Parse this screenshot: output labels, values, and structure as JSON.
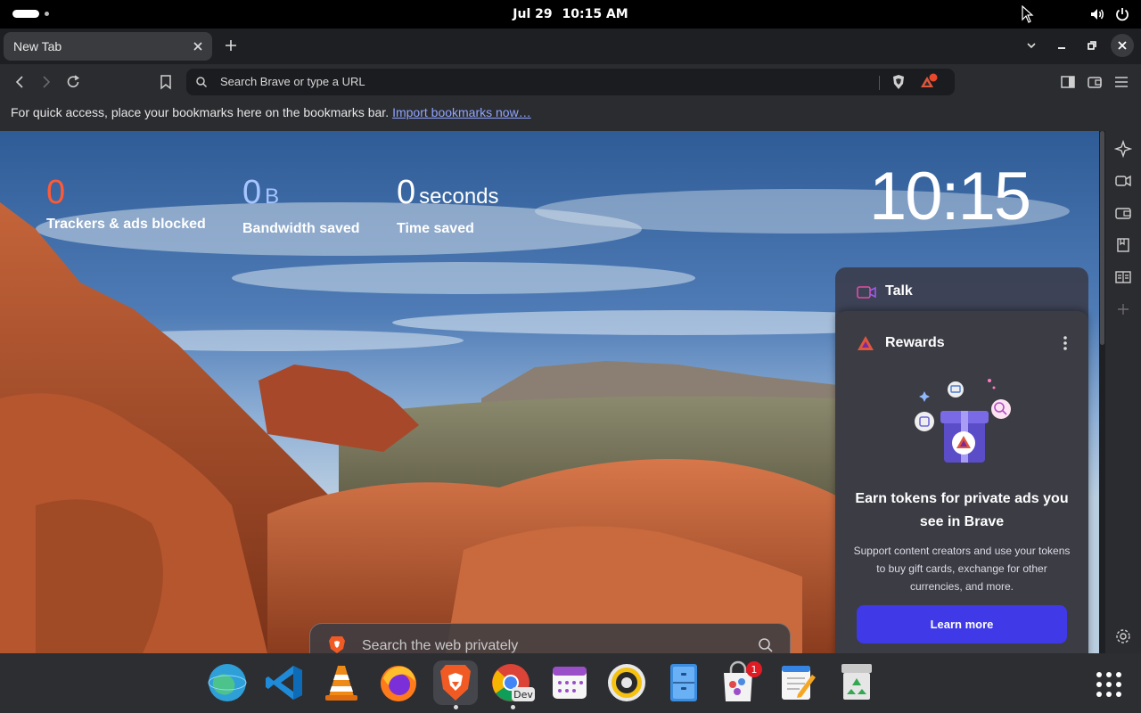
{
  "system": {
    "date": "Jul 29",
    "time": "10:15 AM"
  },
  "browser": {
    "tab_title": "New Tab",
    "omnibox_placeholder": "Search Brave or type a URL",
    "bookmarks_message": "For quick access, place your bookmarks here on the bookmarks bar.",
    "bookmarks_link": "Import bookmarks now…",
    "shield_badge_color": "#e8492c"
  },
  "stats": {
    "trackers": {
      "value": "0",
      "unit": "",
      "label": "Trackers & ads blocked"
    },
    "bandwidth": {
      "value": "0",
      "unit": "B",
      "label": "Bandwidth saved"
    },
    "time": {
      "value": "0",
      "unit": "seconds",
      "label": "Time saved"
    }
  },
  "clock": "10:15",
  "talk": {
    "title": "Talk"
  },
  "rewards": {
    "title": "Rewards",
    "headline": "Earn tokens for private ads you see in Brave",
    "description": "Support content creators and use your tokens to buy gift cards, exchange for other currencies, and more.",
    "button": "Learn more",
    "button_color": "#3f39e8"
  },
  "search": {
    "placeholder": "Search the web privately"
  },
  "dock": {
    "apps": [
      {
        "name": "Web Browser",
        "icon": "globe-icon"
      },
      {
        "name": "Visual Studio Code",
        "icon": "vscode-icon"
      },
      {
        "name": "VLC",
        "icon": "vlc-cone-icon"
      },
      {
        "name": "Firefox",
        "icon": "firefox-icon"
      },
      {
        "name": "Brave",
        "icon": "brave-lion-icon",
        "active": true
      },
      {
        "name": "Chrome Dev",
        "icon": "chrome-dev-icon",
        "label": "Dev",
        "running": true
      },
      {
        "name": "Calendar",
        "icon": "calendar-icon"
      },
      {
        "name": "Rhythmbox",
        "icon": "speaker-icon"
      },
      {
        "name": "Files",
        "icon": "file-cabinet-icon"
      },
      {
        "name": "Software",
        "icon": "software-bag-icon",
        "badge": "1"
      },
      {
        "name": "Text Editor",
        "icon": "text-editor-icon"
      },
      {
        "name": "Trash",
        "icon": "trash-icon"
      }
    ]
  }
}
